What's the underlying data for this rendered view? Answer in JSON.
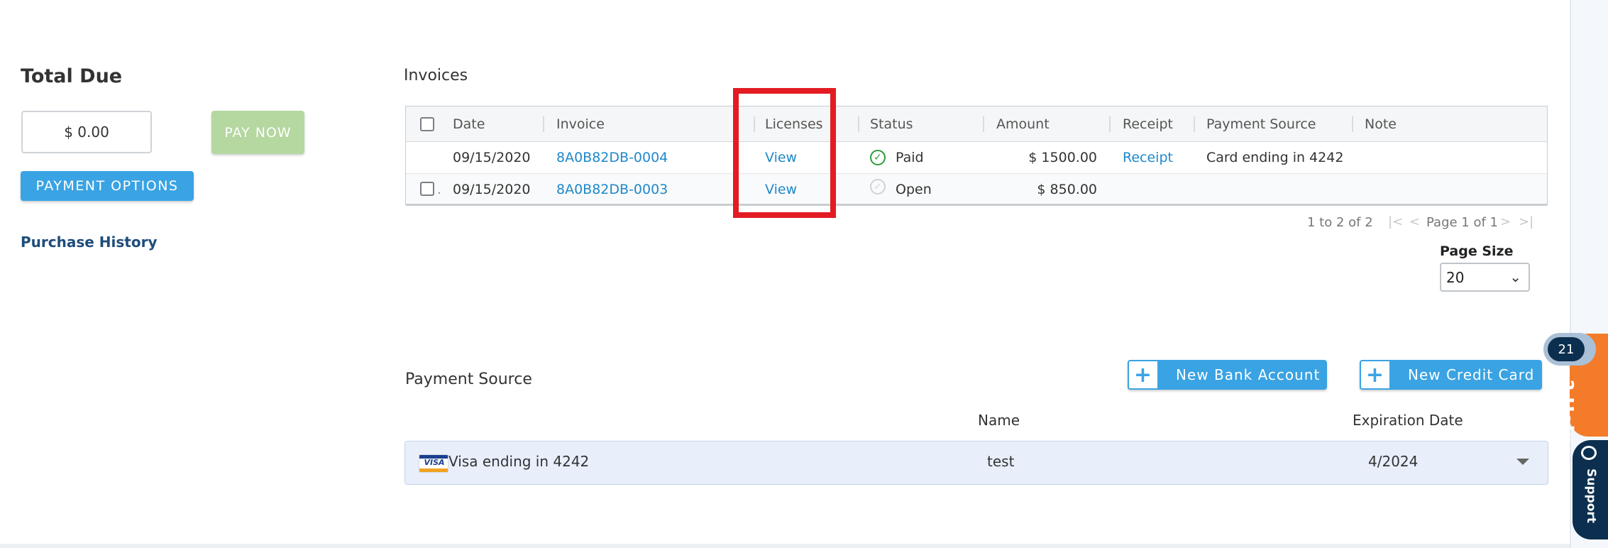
{
  "summary": {
    "title": "Total Due",
    "amount": "$ 0.00",
    "pay_now_label": "PAY NOW",
    "payment_options_label": "PAYMENT OPTIONS",
    "purchase_history_label": "Purchase History"
  },
  "invoices": {
    "title": "Invoices",
    "columns": [
      "Date",
      "Invoice",
      "Licenses",
      "Status",
      "Amount",
      "Receipt",
      "Payment Source",
      "Note"
    ],
    "rows": [
      {
        "date": "09/15/2020",
        "invoice": "8A0B82DB-0004",
        "licenses": "View",
        "status": "Paid",
        "amount": "$ 1500.00",
        "receipt": "Receipt",
        "payment_source": "Card ending in 4242",
        "note": ""
      },
      {
        "date": "09/15/2020",
        "invoice": "8A0B82DB-0003",
        "licenses": "View",
        "status": "Open",
        "amount": "$ 850.00",
        "receipt": "",
        "payment_source": "",
        "note": ""
      }
    ],
    "pager": {
      "summary": "1 to 2 of 2",
      "page_text": "Page 1 of 1",
      "page_size_label": "Page Size",
      "page_size_value": "20"
    }
  },
  "payment_source": {
    "title": "Payment Source",
    "new_bank_label": "New Bank Account",
    "new_card_label": "New Credit Card",
    "columns": {
      "name": "Name",
      "expiration": "Expiration Date"
    },
    "cards": [
      {
        "brand": "VISA",
        "label": "Visa ending in 4242",
        "name": "test",
        "expiration": "4/2024"
      }
    ]
  },
  "widgets": {
    "help_label": "Help",
    "help_badge": "21",
    "support_label": "Support"
  },
  "colors": {
    "accent": "#3aa3e3",
    "link": "#1f88c9",
    "highlight": "#e31b23",
    "paid": "#2e9b3a",
    "help": "#f37b2a",
    "support": "#0c2f4f"
  },
  "icons": [
    "checkbox",
    "paid-check-icon",
    "open-status-icon",
    "first-page-icon",
    "prev-page-icon",
    "next-page-icon",
    "last-page-icon",
    "chevron-down-icon",
    "plus-icon",
    "visa-icon",
    "chat-icon"
  ]
}
